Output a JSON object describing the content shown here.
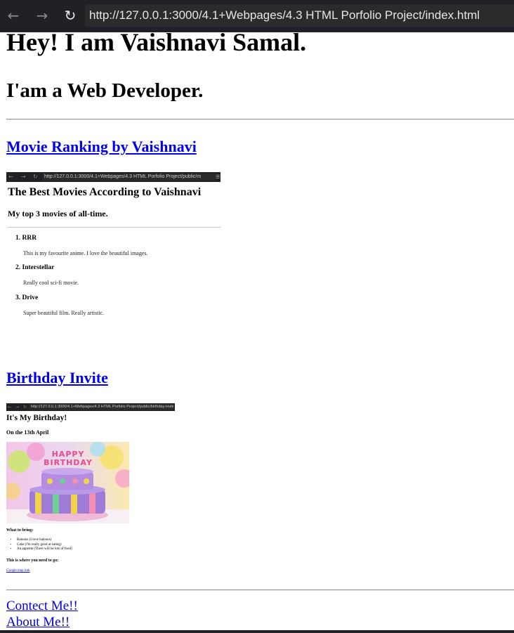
{
  "browser": {
    "url": "http://127.0.0.1:3000/4.1+Webpages/4.3 HTML Porfolio Project/index.html",
    "back_icon": "←",
    "forward_icon": "→",
    "reload_icon": "↻"
  },
  "page": {
    "heading": "Hey! I am Vaishnavi Samal.",
    "subheading": "I'am a Web Developer.",
    "project1_link": "Movie Ranking by Vaishnavi",
    "project2_link": "Birthday Invite",
    "contact_link": "Contect Me!!",
    "about_link": "About Me!!"
  },
  "movie_thumb": {
    "url": "http://127.0.0.1:3000/4.1+Webpages/4.3 HTML Porfolio Project/public/m",
    "title": "The Best Movies According to Vaishnavi",
    "subtitle": "My top 3 movies of all-time.",
    "movies": [
      {
        "rank": "1. RRR",
        "desc": "This is my favourite anime. I love the beautiful images."
      },
      {
        "rank": "2. Interstellar",
        "desc": "Really cool sci-fi movie."
      },
      {
        "rank": "3. Drive",
        "desc": "Super beautiful film. Really artistic."
      }
    ]
  },
  "birthday_thumb": {
    "url": "http://127.0.0.1:3000/4.1+Webpages/4.3 HTML Porfolio Project/public/birthday-invite.html",
    "title": "It's My Birthday!",
    "date": "On the 13th April",
    "cake_text": "HAPPY BIRTHDAY",
    "bring_heading": "What to bring:",
    "bring_items": [
      "Baloons (I love baloons)",
      "Cake (I'm really good at eating)",
      "An appetite (There will be lots of food)"
    ],
    "where_heading": "This is where you need to go:",
    "map_link": "Google map link"
  },
  "colors": {
    "link": "#0000ee",
    "toolbar": "#202124"
  }
}
